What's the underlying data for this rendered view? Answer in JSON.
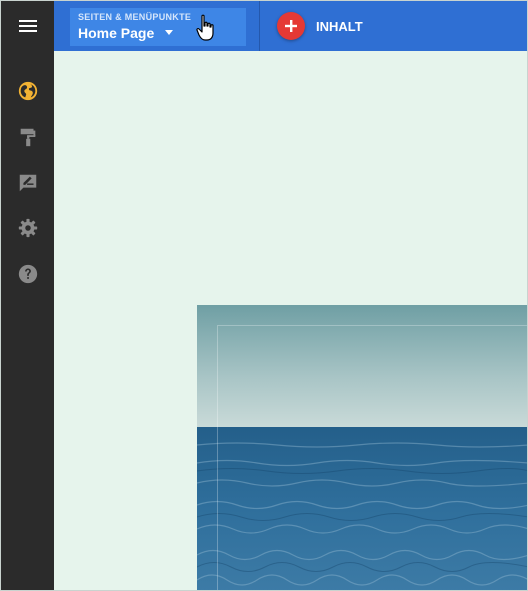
{
  "toolbar": {
    "menu_icon": "hamburger-menu-icon",
    "page_selector": {
      "caption": "SEITEN & MENÜPUNKTE",
      "current_page": "Home Page"
    },
    "add_content": {
      "icon": "plus-icon",
      "label": "INHALT"
    }
  },
  "sidebar": {
    "items": [
      {
        "name": "globe-icon",
        "active": true
      },
      {
        "name": "paint-roller-icon",
        "active": false
      },
      {
        "name": "feedback-edit-icon",
        "active": false
      },
      {
        "name": "gear-icon",
        "active": false
      },
      {
        "name": "help-icon",
        "active": false
      }
    ]
  },
  "colors": {
    "topbar": "#2f6fd3",
    "page_selector": "#3e86e6",
    "sidebar": "#2b2b2b",
    "canvas": "#e6f4ec",
    "accent_active_icon": "#f2b233",
    "inactive_icon": "#8a8a8a",
    "add_button": "#e53935"
  }
}
